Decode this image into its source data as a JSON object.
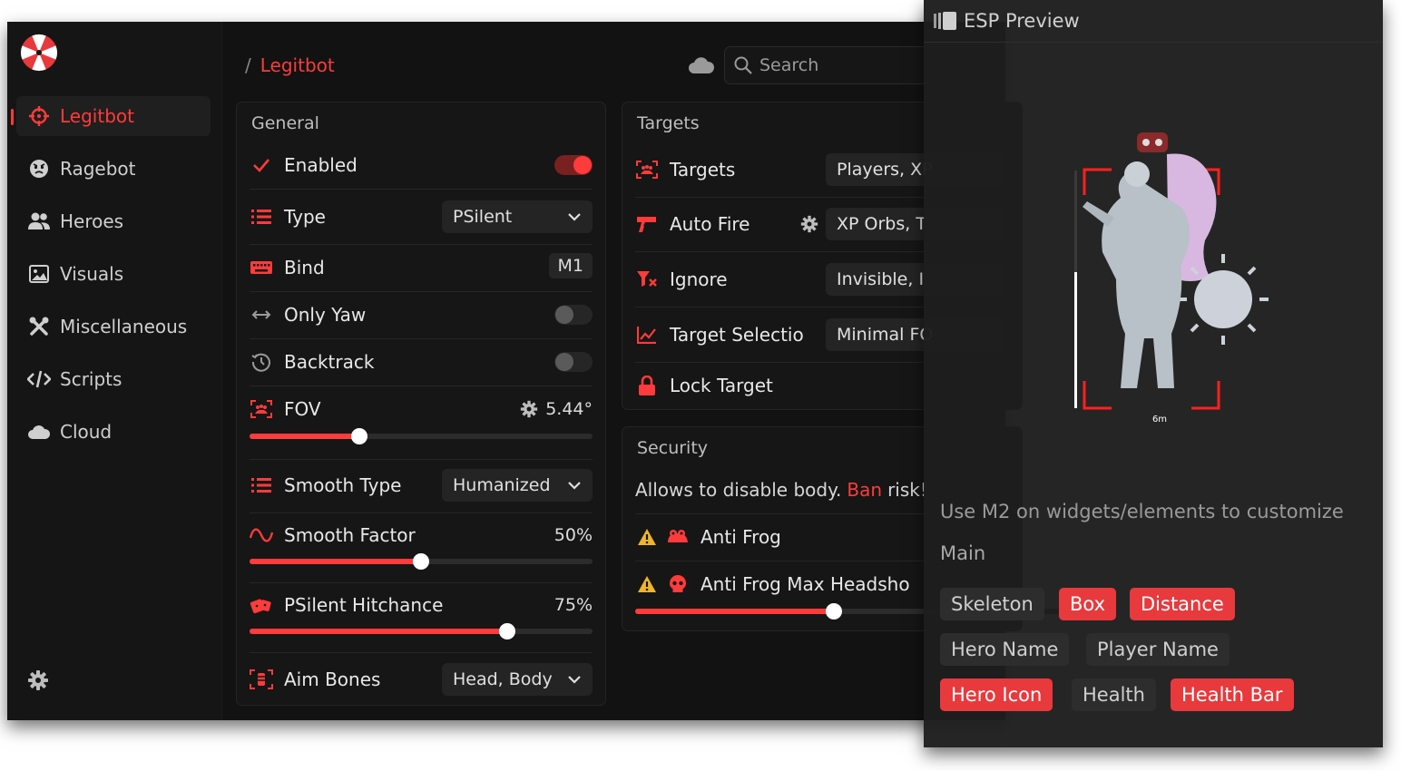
{
  "sidebar": {
    "items": [
      {
        "label": "Legitbot",
        "icon": "crosshair-icon",
        "active": true
      },
      {
        "label": "Ragebot",
        "icon": "angry-face-icon"
      },
      {
        "label": "Heroes",
        "icon": "users-icon"
      },
      {
        "label": "Visuals",
        "icon": "image-icon"
      },
      {
        "label": "Miscellaneous",
        "icon": "tools-icon"
      },
      {
        "label": "Scripts",
        "icon": "code-icon"
      },
      {
        "label": "Cloud",
        "icon": "cloud-icon"
      }
    ]
  },
  "header": {
    "breadcrumb_sep": "/",
    "breadcrumb": "Legitbot",
    "search_placeholder": "Search"
  },
  "general": {
    "title": "General",
    "enabled": {
      "label": "Enabled",
      "on": true
    },
    "type": {
      "label": "Type",
      "value": "PSilent"
    },
    "bind": {
      "label": "Bind",
      "key": "M1"
    },
    "only_yaw": {
      "label": "Only Yaw",
      "on": false
    },
    "backtrack": {
      "label": "Backtrack",
      "on": false
    },
    "fov": {
      "label": "FOV",
      "value": "5.44°",
      "fraction": 0.32
    },
    "smooth_type": {
      "label": "Smooth Type",
      "value": "Humanized"
    },
    "smooth_factor": {
      "label": "Smooth Factor",
      "value": "50%",
      "fraction": 0.5
    },
    "psilent_hitchance": {
      "label": "PSilent Hitchance",
      "value": "75%",
      "fraction": 0.75
    },
    "aim_bones": {
      "label": "Aim Bones",
      "value": "Head, Body"
    }
  },
  "targets": {
    "title": "Targets",
    "targets": {
      "label": "Targets",
      "value": "Players, XP"
    },
    "auto_fire": {
      "label": "Auto Fire",
      "value": "XP Orbs, T"
    },
    "ignore": {
      "label": "Ignore",
      "value": "Invisible, I"
    },
    "target_selection": {
      "label": "Target Selectio",
      "value": "Minimal FO"
    },
    "lock_target": {
      "label": "Lock Target"
    }
  },
  "security": {
    "title": "Security",
    "desc_prefix": "Allows to disable body.",
    "desc_highlight": "Ban",
    "desc_suffix": "risk!",
    "anti_frog": {
      "label": "Anti Frog"
    },
    "anti_frog_max": {
      "label": "Anti Frog Max Headsho",
      "fraction": 0.45
    }
  },
  "esp": {
    "title": "ESP Preview",
    "distance_label": "6m",
    "hint": "Use M2 on widgets/elements to customize",
    "main_label": "Main",
    "tags": [
      {
        "label": "Skeleton",
        "on": false
      },
      {
        "label": "Box",
        "on": true
      },
      {
        "label": "Distance",
        "on": true
      },
      {
        "label": "Hero Name",
        "on": false
      },
      {
        "label": "Player Name",
        "on": false
      },
      {
        "label": "Hero Icon",
        "on": true
      },
      {
        "label": "Health",
        "on": false
      },
      {
        "label": "Health Bar",
        "on": true
      }
    ]
  },
  "colors": {
    "accent": "#ff3b3b",
    "panel": "#161616",
    "bg": "#121212"
  }
}
